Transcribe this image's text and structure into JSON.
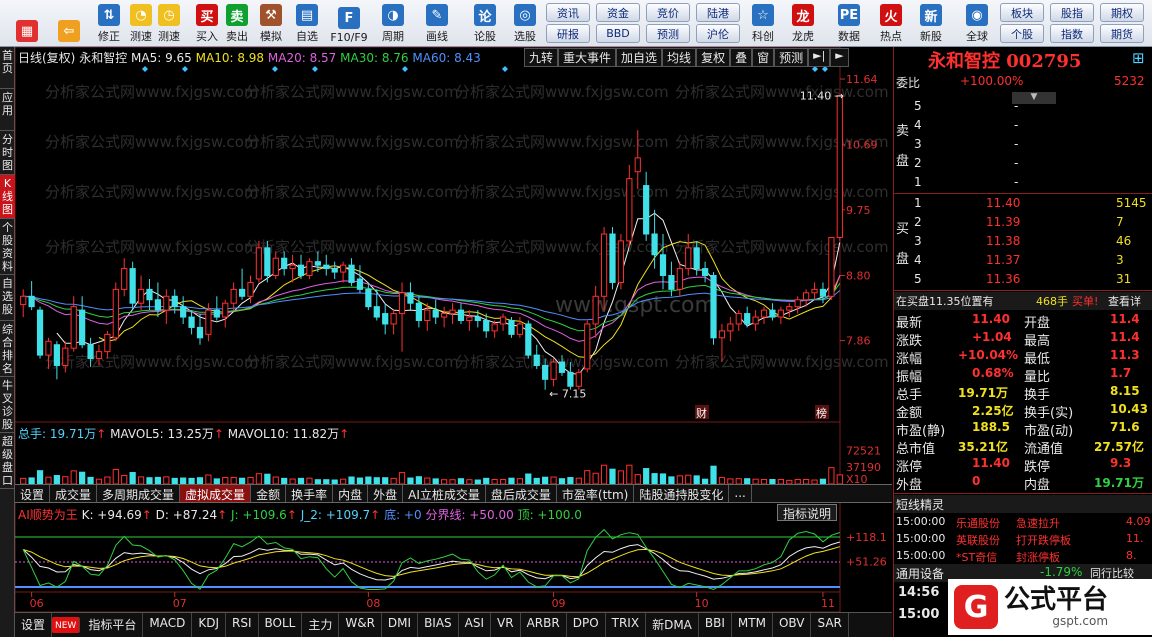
{
  "toolbar": {
    "items": [
      {
        "label": "",
        "icon": "color-grid-icon"
      },
      {
        "label": "",
        "icon": "back-arrow-icon"
      },
      {
        "label": "修正",
        "icon": "edit-arrows-icon"
      },
      {
        "label": "测速",
        "icon": "speed-test-icon"
      },
      {
        "label": "测速",
        "icon": "clock-icon"
      },
      {
        "label": "买入",
        "icon": "buy-icon"
      },
      {
        "label": "卖出",
        "icon": "sell-icon"
      },
      {
        "label": "模拟",
        "icon": "hammer-icon"
      },
      {
        "label": "自选",
        "icon": "folder-icon"
      },
      {
        "label": "F10/F9",
        "icon": "f10-icon"
      },
      {
        "label": "周期",
        "icon": "cycle-icon"
      },
      {
        "label": "画线",
        "icon": "pencil-icon"
      },
      {
        "label": "论股",
        "icon": "forum-icon"
      },
      {
        "label": "选股",
        "icon": "screener-icon"
      },
      {
        "label": "科创",
        "icon": "sci-icon"
      },
      {
        "label": "龙虎",
        "icon": "dragon-icon"
      },
      {
        "label": "数据",
        "icon": "pe-icon"
      },
      {
        "label": "热点",
        "icon": "hot-icon"
      },
      {
        "label": "新股",
        "icon": "new-stock-icon"
      },
      {
        "label": "全球",
        "icon": "globe-icon"
      }
    ],
    "pills_top": [
      "资讯",
      "资金",
      "竞价",
      "陆港",
      "板块",
      "股指",
      "期权"
    ],
    "pills_bottom": [
      "研报",
      "BBD",
      "预测",
      "沪伦",
      "个股",
      "指数",
      "期货"
    ]
  },
  "left_tabs": [
    "首页",
    "应用",
    "分时图",
    "K线图",
    "个股资料",
    "自选股",
    "综合排名",
    "牛叉诊股",
    "超级盘口"
  ],
  "chart": {
    "header": {
      "period": "日线(复权)",
      "name": "永和智控",
      "ma5": "MA5: 9.65",
      "ma10": "MA10: 8.98",
      "ma20": "MA20: 8.57",
      "ma30": "MA30: 8.76",
      "ma60": "MA60: 8.43"
    },
    "right_buttons": [
      "九转",
      "重大事件",
      "加自选",
      "均线",
      "复权",
      "叠",
      "窗",
      "预测"
    ],
    "price_axis": [
      "11.64",
      "10.69",
      "9.75",
      "8.80",
      "7.86"
    ],
    "high_label": "11.40",
    "low_label": "7.15",
    "events": [
      "财",
      "榜"
    ],
    "vol_header": {
      "total": "总手: 19.71万",
      "mavol5": "MAVOL5: 13.25万",
      "mavol10": "MAVOL10: 11.82万"
    },
    "vol_axis": [
      "72521",
      "37190",
      "X10"
    ],
    "tabs": [
      "设置",
      "成交量",
      "多周期成交量",
      "虚拟成交量",
      "金额",
      "换手率",
      "内盘",
      "外盘",
      "AI立桩成交量",
      "盘后成交量",
      "市盈率(ttm)",
      "陆股通持股变化",
      "..."
    ],
    "osc_header": {
      "name": "AI顺势为王",
      "k": "K: +94.69",
      "d": "D: +87.24",
      "j": "J: +109.6",
      "j2": "J_2: +109.7",
      "bottom": "底: +0",
      "split": "分界线: +50.00",
      "top": "顶: +100.0"
    },
    "osc_button": "指标说明",
    "osc_axis": [
      "118.1",
      "51.26"
    ],
    "months": [
      "06",
      "07",
      "08",
      "09",
      "10",
      "11"
    ],
    "watermark": "分析家公式网www.fxjgsw.com",
    "watermark2": "www.gspt.com"
  },
  "chart_data": {
    "type": "candlestick",
    "title": "永和智控 002795 日线(复权)",
    "ylim": [
      6.9,
      11.9
    ],
    "price_ticks": [
      11.64,
      10.69,
      9.75,
      8.8,
      7.86
    ],
    "candles": [
      [
        8.38,
        8.6,
        8.2,
        8.5
      ],
      [
        8.5,
        8.72,
        8.3,
        8.35
      ],
      [
        8.3,
        8.35,
        7.6,
        7.65
      ],
      [
        7.65,
        7.9,
        7.45,
        7.85
      ],
      [
        7.8,
        7.85,
        7.3,
        7.5
      ],
      [
        7.5,
        7.85,
        7.4,
        7.75
      ],
      [
        7.75,
        8.5,
        7.7,
        8.35
      ],
      [
        8.3,
        8.5,
        7.75,
        7.8
      ],
      [
        7.8,
        7.9,
        7.48,
        7.6
      ],
      [
        7.6,
        7.8,
        7.5,
        7.7
      ],
      [
        7.7,
        8.0,
        7.6,
        7.95
      ],
      [
        7.9,
        8.7,
        7.85,
        8.6
      ],
      [
        8.6,
        9.05,
        8.5,
        8.9
      ],
      [
        8.9,
        9.0,
        8.3,
        8.4
      ],
      [
        8.4,
        8.8,
        8.3,
        8.6
      ],
      [
        8.6,
        8.75,
        8.3,
        8.45
      ],
      [
        8.45,
        8.7,
        8.2,
        8.3
      ],
      [
        8.3,
        8.6,
        8.1,
        8.5
      ],
      [
        8.5,
        8.6,
        8.25,
        8.35
      ],
      [
        8.35,
        8.5,
        8.1,
        8.2
      ],
      [
        8.2,
        8.3,
        7.95,
        8.05
      ],
      [
        8.05,
        8.25,
        7.8,
        7.9
      ],
      [
        7.95,
        8.4,
        7.85,
        8.3
      ],
      [
        8.3,
        8.5,
        8.15,
        8.2
      ],
      [
        8.2,
        8.45,
        8.05,
        8.4
      ],
      [
        8.4,
        8.7,
        8.3,
        8.6
      ],
      [
        8.6,
        8.9,
        8.45,
        8.5
      ],
      [
        8.5,
        8.8,
        8.4,
        8.7
      ],
      [
        8.75,
        9.3,
        8.7,
        9.2
      ],
      [
        9.2,
        9.3,
        8.7,
        8.8
      ],
      [
        8.8,
        9.15,
        8.75,
        9.05
      ],
      [
        9.05,
        9.15,
        8.8,
        8.9
      ],
      [
        8.9,
        9.1,
        8.7,
        8.95
      ],
      [
        8.95,
        9.1,
        8.75,
        8.8
      ],
      [
        8.8,
        9.05,
        8.75,
        9.0
      ],
      [
        9.0,
        9.15,
        8.85,
        8.95
      ],
      [
        8.95,
        9.1,
        8.8,
        8.9
      ],
      [
        8.9,
        9.0,
        8.75,
        8.85
      ],
      [
        8.85,
        9.0,
        8.7,
        8.95
      ],
      [
        8.95,
        9.05,
        8.65,
        8.7
      ],
      [
        8.75,
        8.95,
        8.55,
        8.6
      ],
      [
        8.6,
        8.7,
        8.3,
        8.35
      ],
      [
        8.35,
        8.6,
        8.15,
        8.2
      ],
      [
        8.25,
        8.4,
        7.95,
        8.1
      ],
      [
        8.1,
        8.3,
        7.95,
        8.25
      ],
      [
        8.25,
        8.7,
        7.7,
        8.55
      ],
      [
        8.55,
        8.7,
        8.3,
        8.4
      ],
      [
        8.4,
        8.5,
        8.05,
        8.15
      ],
      [
        8.15,
        8.4,
        8.0,
        8.3
      ],
      [
        8.3,
        8.45,
        8.1,
        8.2
      ],
      [
        8.2,
        8.35,
        8.05,
        8.25
      ],
      [
        8.25,
        8.4,
        8.1,
        8.3
      ],
      [
        8.3,
        8.4,
        8.1,
        8.15
      ],
      [
        8.15,
        8.3,
        8.0,
        8.2
      ],
      [
        8.2,
        8.3,
        8.05,
        8.15
      ],
      [
        8.15,
        8.25,
        7.9,
        8.0
      ],
      [
        8.0,
        8.15,
        7.9,
        8.1
      ],
      [
        8.1,
        8.25,
        8.0,
        8.2
      ],
      [
        8.15,
        8.2,
        7.9,
        7.95
      ],
      [
        7.95,
        8.2,
        7.9,
        8.1
      ],
      [
        8.1,
        8.15,
        7.6,
        7.65
      ],
      [
        7.65,
        7.8,
        7.45,
        7.5
      ],
      [
        7.5,
        7.6,
        7.15,
        7.3
      ],
      [
        7.3,
        7.6,
        7.2,
        7.55
      ],
      [
        7.55,
        7.65,
        7.35,
        7.4
      ],
      [
        7.4,
        7.55,
        7.15,
        7.2
      ],
      [
        7.2,
        7.45,
        7.15,
        7.4
      ],
      [
        7.45,
        8.15,
        7.4,
        8.1
      ],
      [
        8.1,
        8.65,
        7.9,
        8.5
      ],
      [
        8.5,
        9.5,
        8.3,
        9.4
      ],
      [
        9.4,
        9.5,
        8.6,
        8.7
      ],
      [
        8.7,
        9.4,
        8.6,
        9.3
      ],
      [
        9.3,
        10.4,
        9.2,
        10.2
      ],
      [
        10.3,
        10.9,
        10.05,
        10.5
      ],
      [
        10.1,
        10.3,
        9.3,
        9.4
      ],
      [
        9.4,
        9.75,
        8.9,
        9.1
      ],
      [
        9.1,
        9.4,
        8.6,
        8.8
      ],
      [
        8.8,
        9.0,
        8.5,
        8.6
      ],
      [
        8.6,
        9.0,
        8.5,
        8.9
      ],
      [
        8.9,
        9.4,
        8.8,
        9.2
      ],
      [
        9.2,
        9.3,
        8.8,
        8.9
      ],
      [
        8.9,
        9.0,
        8.7,
        8.8
      ],
      [
        8.8,
        8.85,
        7.8,
        7.9
      ],
      [
        7.9,
        8.1,
        7.55,
        8.0
      ],
      [
        8.0,
        8.2,
        7.85,
        8.1
      ],
      [
        8.1,
        8.3,
        8.0,
        8.25
      ],
      [
        8.25,
        8.35,
        8.05,
        8.1
      ],
      [
        8.1,
        8.3,
        8.0,
        8.2
      ],
      [
        8.2,
        8.35,
        8.1,
        8.3
      ],
      [
        8.3,
        8.4,
        8.15,
        8.2
      ],
      [
        8.2,
        8.35,
        8.1,
        8.3
      ],
      [
        8.3,
        8.4,
        8.2,
        8.35
      ],
      [
        8.35,
        8.5,
        8.25,
        8.45
      ],
      [
        8.45,
        8.6,
        8.35,
        8.55
      ],
      [
        8.55,
        8.7,
        8.45,
        8.6
      ],
      [
        8.6,
        8.7,
        8.4,
        8.5
      ],
      [
        8.5,
        9.35,
        8.45,
        9.35
      ],
      [
        9.35,
        11.4,
        9.3,
        11.4
      ]
    ],
    "volume_axis": [
      72521,
      37190
    ],
    "osc_axis": [
      118.1,
      51.26
    ]
  },
  "quote": {
    "title": "永和智控 002795",
    "webi_label": "委比",
    "webi": "+100.00%",
    "weicha": "5232",
    "sell_label": [
      "卖",
      "盘"
    ],
    "buy_label": [
      "买",
      "盘"
    ],
    "sells": [
      {
        "n": "5",
        "p": "",
        "v": "-"
      },
      {
        "n": "4",
        "p": "",
        "v": "-"
      },
      {
        "n": "3",
        "p": "",
        "v": "-"
      },
      {
        "n": "2",
        "p": "",
        "v": "-"
      },
      {
        "n": "1",
        "p": "",
        "v": "-"
      }
    ],
    "buys": [
      {
        "n": "1",
        "p": "11.40",
        "v": "5145"
      },
      {
        "n": "2",
        "p": "11.39",
        "v": "7"
      },
      {
        "n": "3",
        "p": "11.38",
        "v": "46"
      },
      {
        "n": "4",
        "p": "11.37",
        "v": "3"
      },
      {
        "n": "5",
        "p": "11.36",
        "v": "31"
      }
    ],
    "buy_note": "在买盘11.35位置有",
    "buy_note_qty": "468手",
    "buy_note_act": "买单!",
    "buy_note_link": "查看详",
    "stats": [
      {
        "a": "最新",
        "b": "11.40",
        "c": "开盘",
        "d": "11.4"
      },
      {
        "a": "涨跌",
        "b": "+1.04",
        "c": "最高",
        "d": "11.4"
      },
      {
        "a": "涨幅",
        "b": "+10.04%",
        "c": "最低",
        "d": "11.3"
      },
      {
        "a": "振幅",
        "b": "0.68%",
        "c": "量比",
        "d": "1.7"
      },
      {
        "a": "总手",
        "b": "19.71万",
        "c": "换手",
        "d": "8.15"
      },
      {
        "a": "金额",
        "b": "2.25亿",
        "c": "换手(实)",
        "d": "10.43"
      },
      {
        "a": "市盈(静)",
        "b": "188.5",
        "c": "市盈(动)",
        "d": "71.6"
      },
      {
        "a": "总市值",
        "b": "35.21亿",
        "c": "流通值",
        "d": "27.57亿"
      },
      {
        "a": "涨停",
        "b": "11.40",
        "c": "跌停",
        "d": "9.3"
      },
      {
        "a": "外盘",
        "b": "0",
        "c": "内盘",
        "d": "19.71万"
      }
    ],
    "elf_title": "短线精灵",
    "elf": [
      {
        "t": "15:00:00",
        "s": "乐通股份",
        "e": "急速拉升",
        "v": "4.09"
      },
      {
        "t": "15:00:00",
        "s": "英联股份",
        "e": "打开跌停板",
        "v": "11."
      },
      {
        "t": "15:00:00",
        "s": "*ST奇信",
        "e": "封涨停板",
        "v": "8."
      }
    ],
    "device": "通用设备",
    "device_chg": "-1.79%",
    "device_link": "同行比较",
    "time": "14:56",
    "time2": "15:00"
  },
  "indicators": [
    "设置",
    "NEW",
    "指标平台",
    "MACD",
    "KDJ",
    "RSI",
    "BOLL",
    "主力",
    "W&R",
    "DMI",
    "BIAS",
    "ASI",
    "VR",
    "ARBR",
    "DPO",
    "TRIX",
    "新DMA",
    "BBI",
    "MTM",
    "OBV",
    "SAR"
  ],
  "brand": {
    "logo_text": "公式平台",
    "site": "gspt.com"
  }
}
